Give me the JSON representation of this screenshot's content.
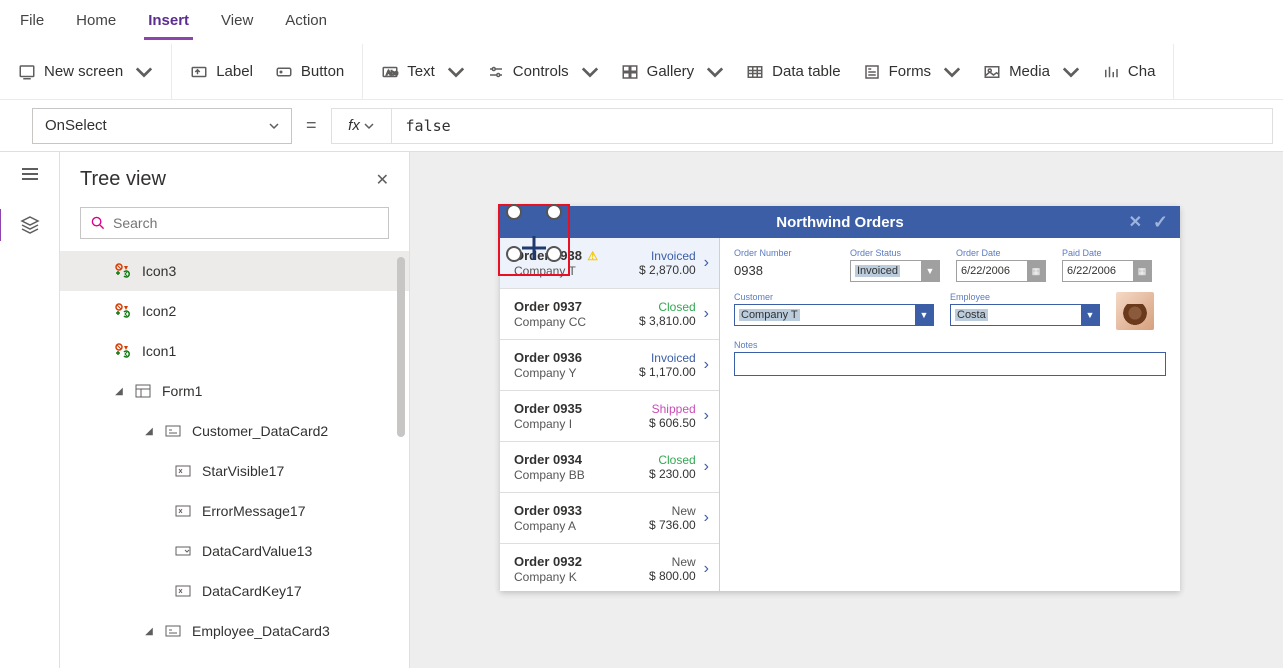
{
  "menubar": {
    "items": [
      "File",
      "Home",
      "Insert",
      "View",
      "Action"
    ],
    "active": 2
  },
  "ribbon": {
    "new_screen": "New screen",
    "label": "Label",
    "button": "Button",
    "text": "Text",
    "controls": "Controls",
    "gallery": "Gallery",
    "data_table": "Data table",
    "forms": "Forms",
    "media": "Media",
    "charts": "Cha"
  },
  "formula": {
    "property": "OnSelect",
    "equals": "=",
    "fx": "fx",
    "value": "false"
  },
  "tree": {
    "title": "Tree view",
    "search_placeholder": "Search",
    "nodes": {
      "icon3": "Icon3",
      "icon2": "Icon2",
      "icon1": "Icon1",
      "form1": "Form1",
      "customer_dc": "Customer_DataCard2",
      "star": "StarVisible17",
      "err": "ErrorMessage17",
      "dcv": "DataCardValue13",
      "dck": "DataCardKey17",
      "employee_dc": "Employee_DataCard3"
    }
  },
  "app": {
    "title": "Northwind Orders",
    "orders": [
      {
        "num": "Order 0938",
        "company": "Company T",
        "status": "Invoiced",
        "amount": "$ 2,870.00",
        "warn": true,
        "sel": true
      },
      {
        "num": "Order 0937",
        "company": "Company CC",
        "status": "Closed",
        "amount": "$ 3,810.00"
      },
      {
        "num": "Order 0936",
        "company": "Company Y",
        "status": "Invoiced",
        "amount": "$ 1,170.00"
      },
      {
        "num": "Order 0935",
        "company": "Company I",
        "status": "Shipped",
        "amount": "$ 606.50"
      },
      {
        "num": "Order 0934",
        "company": "Company BB",
        "status": "Closed",
        "amount": "$ 230.00"
      },
      {
        "num": "Order 0933",
        "company": "Company A",
        "status": "New",
        "amount": "$ 736.00"
      },
      {
        "num": "Order 0932",
        "company": "Company K",
        "status": "New",
        "amount": "$ 800.00"
      }
    ],
    "detail": {
      "order_number_label": "Order Number",
      "order_number": "0938",
      "order_status_label": "Order Status",
      "order_status": "Invoiced",
      "order_date_label": "Order Date",
      "order_date": "6/22/2006",
      "paid_date_label": "Paid Date",
      "paid_date": "6/22/2006",
      "customer_label": "Customer",
      "customer": "Company T",
      "employee_label": "Employee",
      "employee": "Costa",
      "notes_label": "Notes"
    }
  }
}
